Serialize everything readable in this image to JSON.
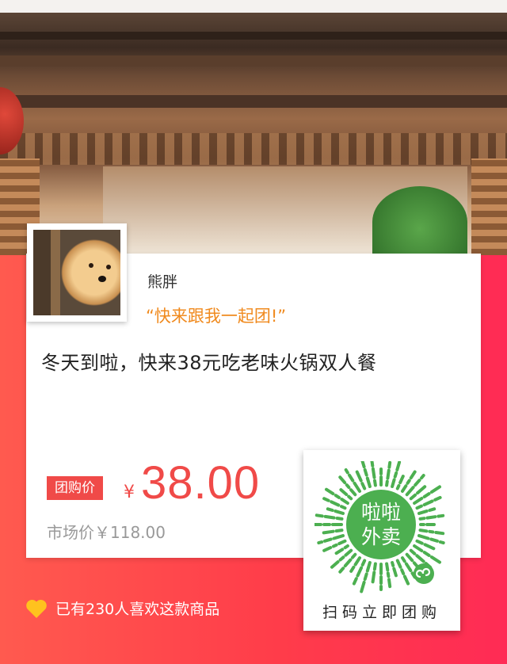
{
  "profile": {
    "username": "熊胖",
    "slogan": "“快来跟我一起团!”"
  },
  "deal": {
    "title": "冬天到啦，快来38元吃老味火锅双人餐",
    "tag_label": "团购价",
    "currency_symbol": "¥",
    "price": "38.00",
    "market_price_label": "市场价￥118.00"
  },
  "qr": {
    "center_text_line1": "啦啦",
    "center_text_line2": "外卖",
    "caption": "扫码立即团购",
    "brand_color": "#4caf50"
  },
  "likes": {
    "text": "已有230人喜欢这款商品",
    "icon": "heart-icon",
    "icon_color": "#ffc21e"
  },
  "colors": {
    "accent": "#f04a48",
    "slogan": "#f08a1e"
  }
}
